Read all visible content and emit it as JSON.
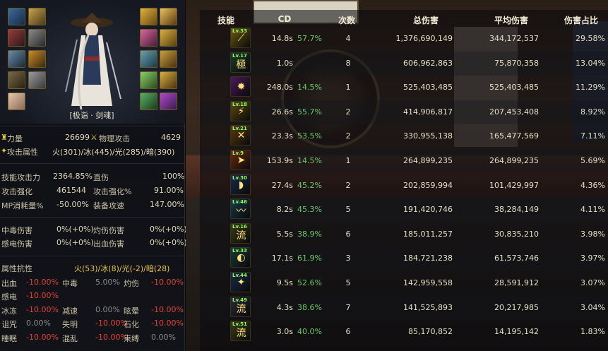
{
  "character": {
    "title": "[极诣 · 剑魂]"
  },
  "stats": {
    "strength_label": "力量",
    "strength_value": "26699",
    "phys_atk_label": "物理攻击",
    "phys_atk_value": "4629",
    "atk_attr_label": "攻击属性",
    "atk_attr_value": "火(301)/冰(445)/光(285)/暗(390)",
    "skill_atk_label": "技能攻击力",
    "skill_atk_value": "2364.85%",
    "direct_label": "直伤",
    "direct_value": "100%",
    "atk_boost_label": "攻击强化",
    "atk_boost_value": "461544",
    "atk_boost_pct_label": "攻击强化%",
    "atk_boost_pct_value": "91.00%",
    "mp_label": "MP消耗量%",
    "mp_value": "-50.00%",
    "equip_speed_label": "装备攻速",
    "equip_speed_value": "147.00%",
    "poison_label": "中毒伤害",
    "poison_value": "0%(+0%)",
    "burn_label": "灼伤伤害",
    "burn_value": "0%(+0%)",
    "shock_label": "感电伤害",
    "shock_value": "0%(+0%)",
    "bleed_label": "出血伤害",
    "bleed_value": "0%(+0%)",
    "resist_label": "属性抗性",
    "resist_value": "火(53)/冰(8)/光(-2)/暗(28)"
  },
  "ailments": [
    {
      "name": "出血",
      "value": "-10.00%",
      "neg": true,
      "name2": "中毒",
      "value2": "5.00%",
      "neg2": false,
      "name3": "灼伤",
      "value3": "-10.00%",
      "neg3": true
    },
    {
      "name": "感电",
      "value": "-10.00%",
      "neg": true,
      "name2": "",
      "value2": "",
      "neg2": false,
      "name3": "",
      "value3": "",
      "neg3": false
    },
    {
      "name": "冰冻",
      "value": "-10.00%",
      "neg": true,
      "name2": "减速",
      "value2": "0.00%",
      "neg2": false,
      "name3": "眩晕",
      "value3": "-10.00%",
      "neg3": true
    },
    {
      "name": "诅咒",
      "value": "0.00%",
      "neg": false,
      "name2": "失明",
      "value2": "-10.00%",
      "neg2": true,
      "name3": "石化",
      "value3": "-10.00%",
      "neg3": true
    },
    {
      "name": "睡眠",
      "value": "-10.00%",
      "neg": true,
      "name2": "混乱",
      "value2": "-10.00%",
      "neg2": true,
      "name3": "束缚",
      "value3": "0.00%",
      "neg3": false
    }
  ],
  "table": {
    "headers": [
      "技能",
      "CD",
      "次数",
      "总伤害",
      "平均伤害",
      "伤害占比"
    ],
    "rows": [
      {
        "lv": "Lv.33",
        "glyph": "⟋",
        "icon_color": "#6a5a10",
        "cd": "14.8s",
        "cd_pct": "57.7%",
        "count": "4",
        "total": "1,376,690,149",
        "avg": "344,172,537",
        "pct": "29.58%"
      },
      {
        "lv": "Lv.17",
        "glyph": "極",
        "icon_color": "#1a3a2a",
        "cd": "1.0s",
        "cd_pct": "",
        "count": "8",
        "total": "606,962,863",
        "avg": "75,870,358",
        "pct": "13.04%"
      },
      {
        "lv": "",
        "glyph": "✸",
        "icon_color": "#4a1a5a",
        "cd": "248.0s",
        "cd_pct": "14.5%",
        "count": "1",
        "total": "525,403,485",
        "avg": "525,403,485",
        "pct": "11.29%"
      },
      {
        "lv": "Lv.18",
        "glyph": "⚡",
        "icon_color": "#5a4a10",
        "cd": "26.6s",
        "cd_pct": "55.7%",
        "count": "2",
        "total": "414,906,817",
        "avg": "207,453,408",
        "pct": "8.92%"
      },
      {
        "lv": "Lv.21",
        "glyph": "✕",
        "icon_color": "#5a3a10",
        "cd": "23.3s",
        "cd_pct": "53.5%",
        "count": "2",
        "total": "330,955,138",
        "avg": "165,477,569",
        "pct": "7.11%"
      },
      {
        "lv": "Lv.9",
        "glyph": "➤",
        "icon_color": "#6a2a10",
        "cd": "153.9s",
        "cd_pct": "14.5%",
        "count": "1",
        "total": "264,899,235",
        "avg": "264,899,235",
        "pct": "5.69%"
      },
      {
        "lv": "Lv.30",
        "glyph": "◗",
        "icon_color": "#1a2a4a",
        "cd": "27.4s",
        "cd_pct": "45.2%",
        "count": "2",
        "total": "202,859,994",
        "avg": "101,429,997",
        "pct": "4.36%"
      },
      {
        "lv": "Lv.46",
        "glyph": "〰",
        "icon_color": "#1a3a4a",
        "cd": "8.2s",
        "cd_pct": "45.3%",
        "count": "5",
        "total": "191,420,746",
        "avg": "38,284,149",
        "pct": "4.11%"
      },
      {
        "lv": "Lv.16",
        "glyph": "流",
        "icon_color": "#3a3a1a",
        "cd": "5.5s",
        "cd_pct": "38.9%",
        "count": "6",
        "total": "185,011,257",
        "avg": "30,835,210",
        "pct": "3.98%"
      },
      {
        "lv": "Lv.33",
        "glyph": "◐",
        "icon_color": "#1a3a3a",
        "cd": "17.1s",
        "cd_pct": "61.9%",
        "count": "3",
        "total": "184,721,238",
        "avg": "61,573,746",
        "pct": "3.97%"
      },
      {
        "lv": "Lv.44",
        "glyph": "✦",
        "icon_color": "#1a2a4a",
        "cd": "9.5s",
        "cd_pct": "52.6%",
        "count": "5",
        "total": "142,959,558",
        "avg": "28,591,912",
        "pct": "3.07%"
      },
      {
        "lv": "Lv.49",
        "glyph": "流",
        "icon_color": "#2a2a3a",
        "cd": "4.3s",
        "cd_pct": "38.6%",
        "count": "7",
        "total": "141,525,893",
        "avg": "20,217,985",
        "pct": "3.04%"
      },
      {
        "lv": "Lv.51",
        "glyph": "流",
        "icon_color": "#3a3a1a",
        "cd": "3.0s",
        "cd_pct": "40.0%",
        "count": "6",
        "total": "85,170,852",
        "avg": "14,195,142",
        "pct": "1.83%"
      }
    ]
  }
}
